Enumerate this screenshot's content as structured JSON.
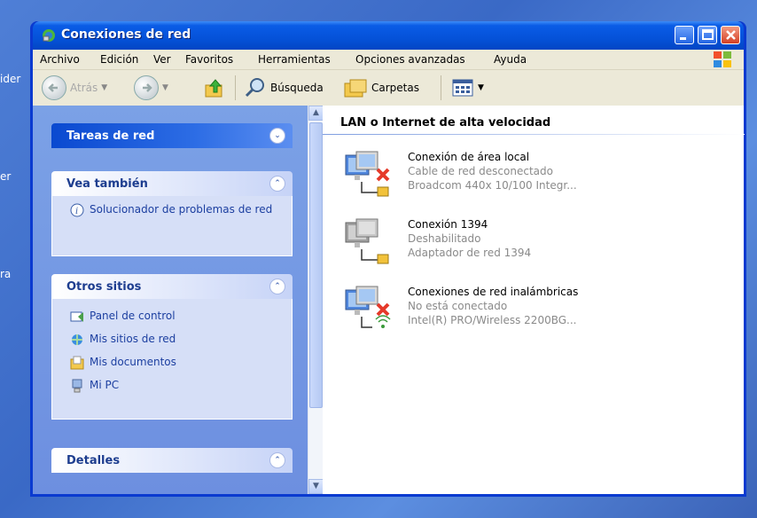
{
  "desktop": {
    "labels": [
      "ider",
      "er",
      "ra"
    ]
  },
  "window": {
    "title": "Conexiones de red"
  },
  "menu": [
    "Archivo",
    "Edición",
    "Ver",
    "Favoritos",
    "Herramientas",
    "Opciones avanzadas",
    "Ayuda"
  ],
  "toolbar": {
    "back": "Atrás",
    "search": "Búsqueda",
    "folders": "Carpetas"
  },
  "tasks": {
    "net_title": "Tareas de red",
    "see_also_title": "Vea también",
    "see_also": [
      "Solucionador de problemas de red"
    ],
    "other_title": "Otros sitios",
    "other": [
      "Panel de control",
      "Mis sitios de red",
      "Mis documentos",
      "Mi PC"
    ],
    "details_title": "Detalles"
  },
  "group": {
    "header": "LAN o Internet de alta velocidad"
  },
  "connections": [
    {
      "name": "Conexión de área local",
      "status": "Cable de red desconectado",
      "device": "Broadcom 440x 10/100 Integr..."
    },
    {
      "name": "Conexión 1394",
      "status": "Deshabilitado",
      "device": "Adaptador de red 1394"
    },
    {
      "name": "Conexiones de red inalámbricas",
      "status": "No está conectado",
      "device": "Intel(R) PRO/Wireless 2200BG..."
    }
  ]
}
